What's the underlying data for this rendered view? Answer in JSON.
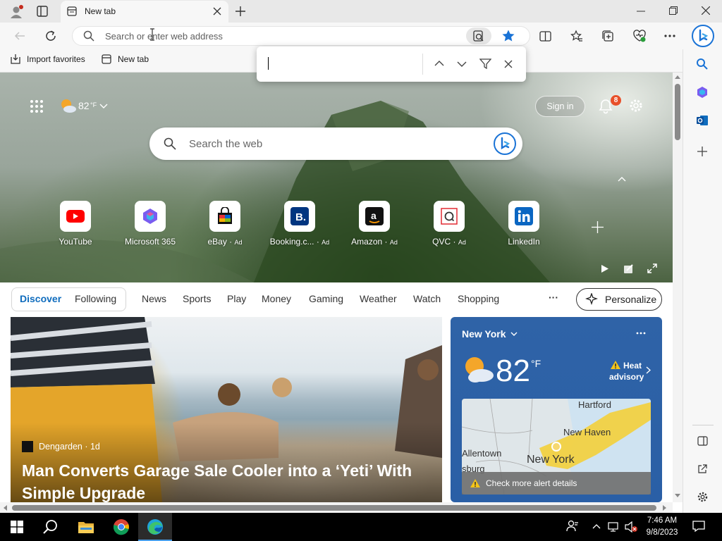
{
  "browser": {
    "tab_title": "New tab",
    "address_placeholder": "Search or enter web address",
    "favorites": [
      "Import favorites",
      "New tab"
    ]
  },
  "find_bar": {
    "value": ""
  },
  "hero": {
    "weather_temp": "82",
    "weather_unit": "°F",
    "sign_in": "Sign in",
    "notification_count": "8",
    "search_placeholder": "Search the web",
    "tiles": [
      {
        "label": "YouTube",
        "ad": "",
        "icon": "youtube-icon"
      },
      {
        "label": "Microsoft 365",
        "ad": "",
        "icon": "microsoft365-icon"
      },
      {
        "label": "eBay",
        "ad": "Ad",
        "icon": "ebay-icon"
      },
      {
        "label": "Booking.c...",
        "ad": "Ad",
        "icon": "booking-icon"
      },
      {
        "label": "Amazon",
        "ad": "Ad",
        "icon": "amazon-icon"
      },
      {
        "label": "QVC",
        "ad": "Ad",
        "icon": "qvc-icon"
      },
      {
        "label": "LinkedIn",
        "ad": "",
        "icon": "linkedin-icon"
      }
    ]
  },
  "feed": {
    "tabs": [
      "Discover",
      "Following"
    ],
    "nav": [
      "News",
      "Sports",
      "Play",
      "Money",
      "Gaming",
      "Weather",
      "Watch",
      "Shopping"
    ],
    "more": "···",
    "personalize": "Personalize"
  },
  "article": {
    "source": "Dengarden · 1d",
    "title": "Man Converts Garage Sale Cooler into a ‘Yeti’ With Simple Upgrade"
  },
  "weather_card": {
    "location": "New York",
    "temp": "82",
    "unit": "°F",
    "alert": "Heat advisory",
    "alert_line1": "Heat",
    "alert_line2": "advisory",
    "map_labels": [
      "Hartford",
      "New Haven",
      "Allentown",
      "New York",
      "sburg"
    ],
    "alert_details": "Check more alert details"
  },
  "taskbar": {
    "time": "7:46 AM",
    "date": "9/8/2023"
  },
  "colors": {
    "accent": "#0f6cbd",
    "weather_card": "#2f63a7",
    "notification_badge": "#e8502a"
  }
}
